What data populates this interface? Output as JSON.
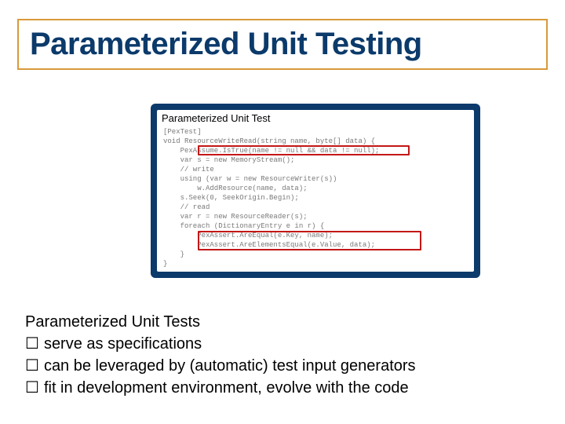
{
  "title": "Parameterized Unit Testing",
  "code_panel": {
    "tab_label": "Parameterized Unit Test",
    "lines": [
      "[PexTest]",
      "void ResourceWriteRead(string name, byte[] data) {",
      "    PexAssume.IsTrue(name != null && data != null);",
      "    var s = new MemoryStream();",
      "    // write",
      "    using (var w = new ResourceWriter(s))",
      "        w.AddResource(name, data);",
      "    s.Seek(0, SeekOrigin.Begin);",
      "    // read",
      "    var r = new ResourceReader(s);",
      "    foreach (DictionaryEntry e in r) {",
      "        PexAssert.AreEqual(e.Key, name);",
      "        PexAssert.AreElementsEqual(e.Value, data);",
      "    }",
      "}"
    ]
  },
  "summary": {
    "heading": "Parameterized Unit Tests",
    "items": [
      "serve as specifications",
      "can be leveraged by (automatic) test input generators",
      "fit in development environment, evolve with the code"
    ]
  },
  "checkbox_glyph": "☐"
}
